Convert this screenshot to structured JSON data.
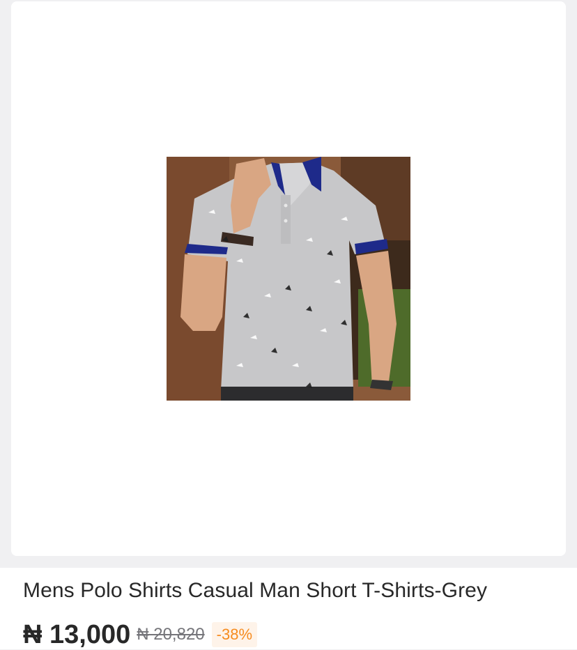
{
  "product": {
    "title": "Mens Polo Shirts Casual Man Short T-Shirts-Grey",
    "price": "₦ 13,000",
    "old_price": "₦ 20,820",
    "discount": "-38%",
    "image_alt": "Mens Polo Shirts Casual Man Short T-Shirts-Grey"
  },
  "colors": {
    "price_text": "#282828",
    "old_price_text": "#75757a",
    "discount_text": "#f68b1e",
    "discount_bg": "#fef3e9",
    "page_bg": "#f0f0f2"
  }
}
